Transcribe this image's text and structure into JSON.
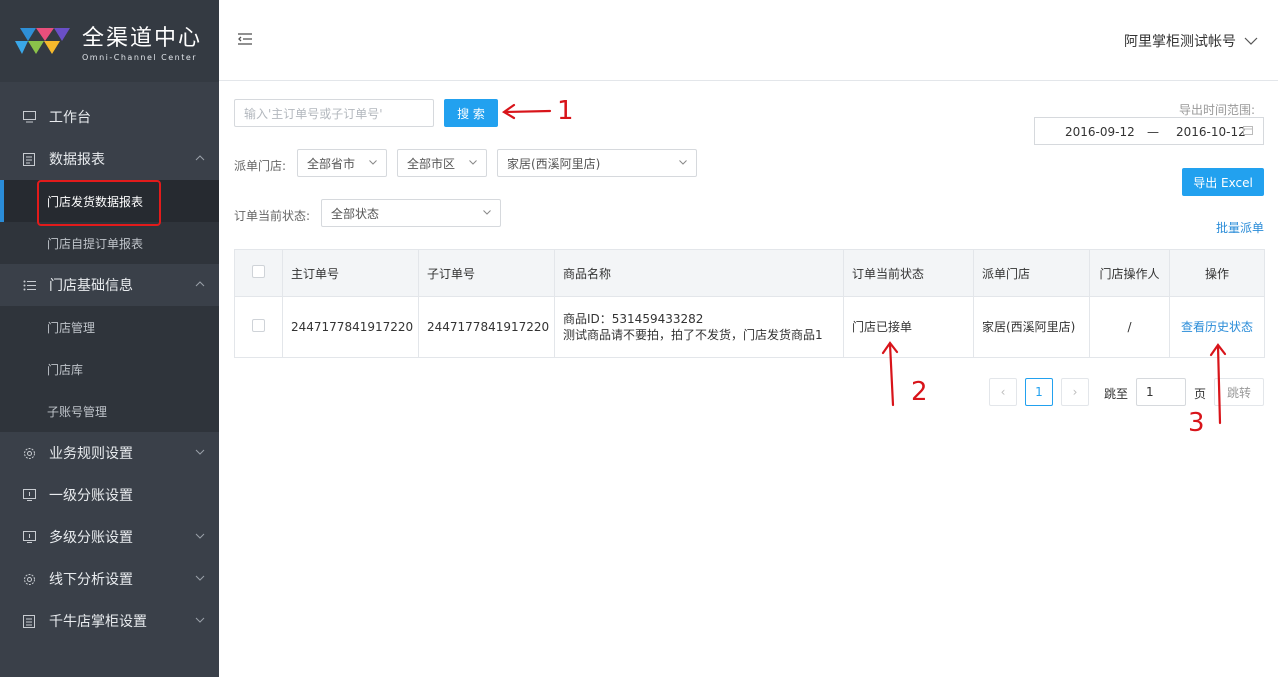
{
  "logo": {
    "cn": "全渠道中心",
    "en": "Omni-Channel Center"
  },
  "sidebar": {
    "items": [
      {
        "label": "工作台",
        "icon": "monitor-icon"
      },
      {
        "label": "数据报表",
        "icon": "report-icon",
        "expanded": true,
        "children": [
          "门店发货数据报表",
          "门店自提订单报表"
        ]
      },
      {
        "label": "门店基础信息",
        "icon": "list-icon",
        "expanded": true,
        "children": [
          "门店管理",
          "门店库",
          "子账号管理"
        ]
      },
      {
        "label": "业务规则设置",
        "icon": "gear-icon"
      },
      {
        "label": "一级分账设置",
        "icon": "account-icon"
      },
      {
        "label": "多级分账设置",
        "icon": "account-icon"
      },
      {
        "label": "线下分析设置",
        "icon": "gear-icon"
      },
      {
        "label": "千牛店掌柜设置",
        "icon": "doc-icon"
      }
    ]
  },
  "header": {
    "account": "阿里掌柜测试帐号"
  },
  "search": {
    "placeholder": "输入'主订单号或子订单号'",
    "button": "搜 索"
  },
  "export": {
    "range_label": "导出时间范围:",
    "start": "2016-09-12",
    "sep": "—",
    "end": "2016-10-12",
    "button": "导出 Excel"
  },
  "filters": {
    "store_label": "派单门店:",
    "province": "全部省市",
    "city": "全部市区",
    "store": "家居(西溪阿里店)",
    "status_label": "订单当前状态:",
    "status": "全部状态"
  },
  "batch_link": "批量派单",
  "table": {
    "headers": [
      "主订单号",
      "子订单号",
      "商品名称",
      "订单当前状态",
      "派单门店",
      "门店操作人",
      "操作"
    ],
    "rows": [
      {
        "main_order": "2447177841917220",
        "sub_order": "2447177841917220",
        "product_id": "商品ID：531459433282",
        "product_name": "测试商品请不要拍，拍了不发货，门店发货商品1",
        "status": "门店已接单",
        "store": "家居(西溪阿里店)",
        "operator": "/",
        "action": "查看历史状态"
      }
    ]
  },
  "pagination": {
    "prev": "‹",
    "current": "1",
    "next": "›",
    "goto_label": "跳至",
    "goto_value": "1",
    "page_unit": "页",
    "jump": "跳转"
  },
  "annotations": [
    "1",
    "2",
    "3"
  ],
  "colors": {
    "sidebar": "#3a4049",
    "primary": "#22a1ef",
    "annotation": "#d8141a"
  }
}
